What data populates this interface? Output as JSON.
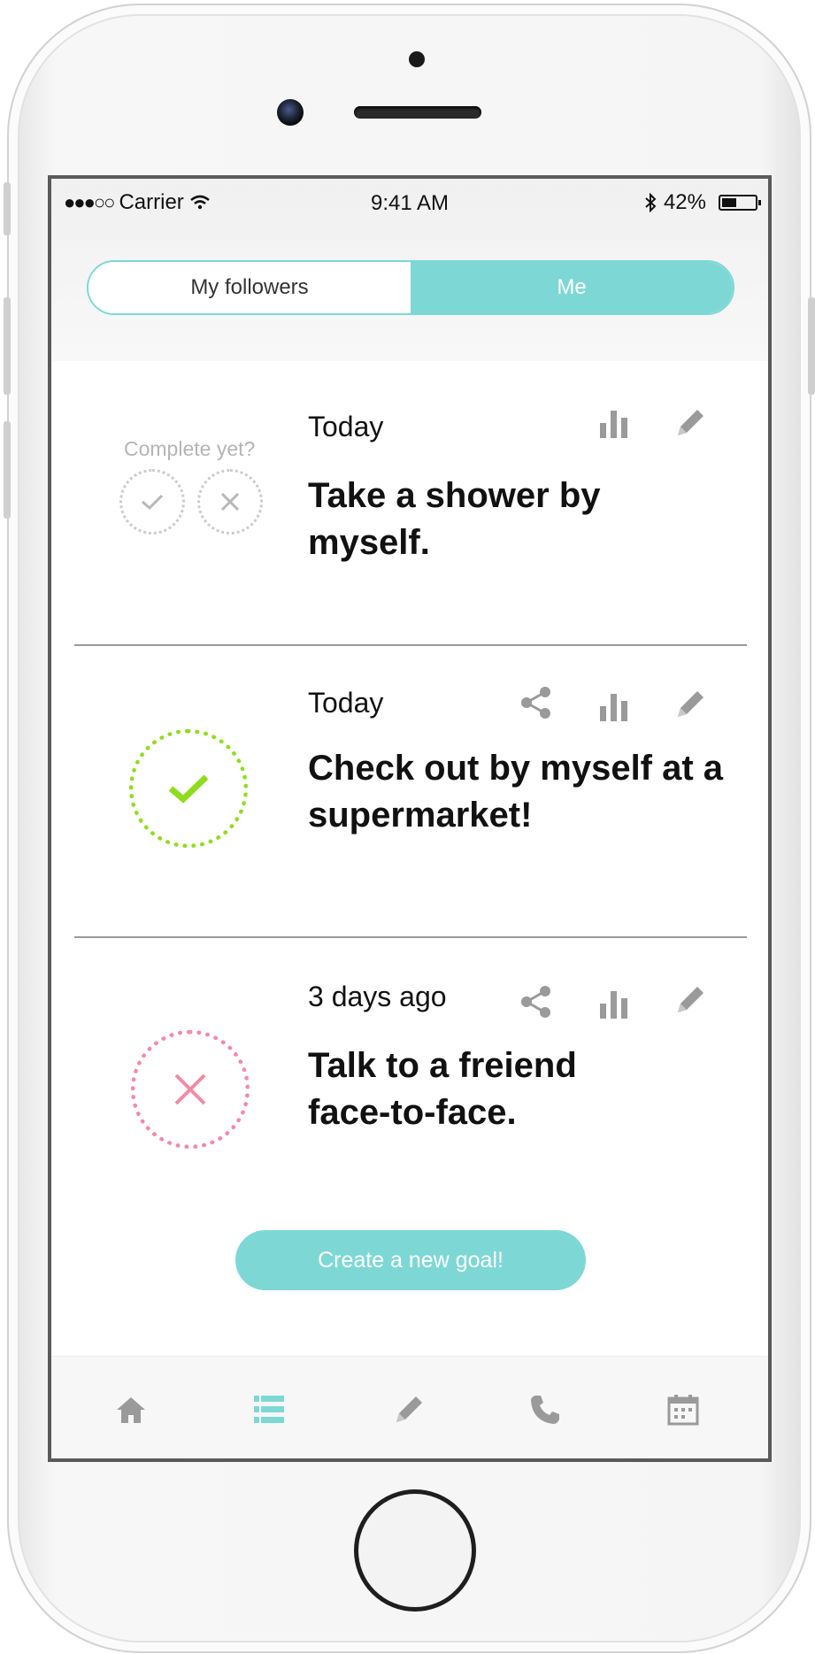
{
  "status_bar": {
    "signal": "●●●○○",
    "carrier": "Carrier",
    "time": "9:41 AM",
    "battery_percent": "42%",
    "battery_level": 0.42
  },
  "segmented_control": {
    "options": [
      "My followers",
      "Me"
    ],
    "selected": "Me"
  },
  "goals": [
    {
      "date": "Today",
      "title": "Take a shower by myself.",
      "status": "pending",
      "complete_prompt": "Complete yet?",
      "actions": [
        "stats-icon",
        "edit-icon"
      ]
    },
    {
      "date": "Today",
      "title": "Check out by myself at a supermarket!",
      "status": "completed",
      "actions": [
        "share-icon",
        "stats-icon",
        "edit-icon"
      ]
    },
    {
      "date": "3 days ago",
      "title": "Talk to a freiend face-to-face.",
      "status": "failed",
      "actions": [
        "share-icon",
        "stats-icon",
        "edit-icon"
      ]
    }
  ],
  "create_button": {
    "label": "Create a new goal!"
  },
  "tab_bar": {
    "tabs": [
      {
        "icon": "home-icon"
      },
      {
        "icon": "list-icon",
        "active": true
      },
      {
        "icon": "pencil-icon"
      },
      {
        "icon": "phone-icon"
      },
      {
        "icon": "calendar-icon"
      }
    ]
  },
  "colors": {
    "accent": "#7dd8d5",
    "success": "#8fdc1f",
    "failure": "#f28ba4",
    "icon_gray": "#9a9a9a"
  }
}
